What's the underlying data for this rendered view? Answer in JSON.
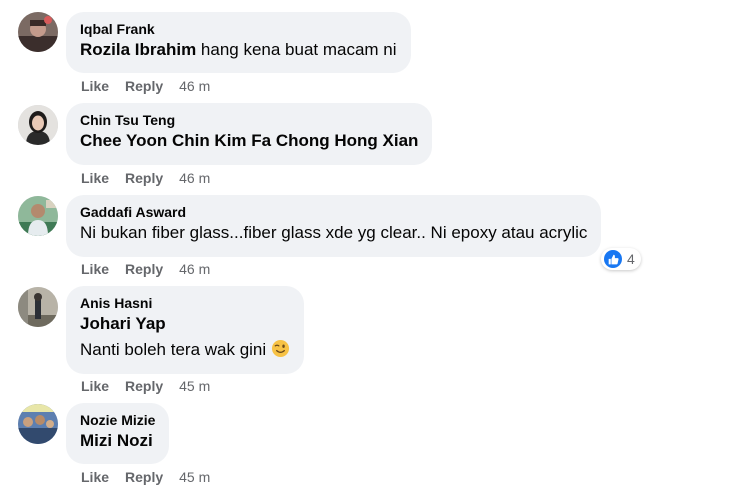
{
  "comments": [
    {
      "author": "Iqbal Frank",
      "mention": "Rozila Ibrahim",
      "text": " hang kena buat macam ni",
      "actions": {
        "like": "Like",
        "reply": "Reply"
      },
      "time": "46 m"
    },
    {
      "author": "Chin Tsu Teng",
      "mention": "Chee Yoon Chin Kim Fa Chong Hong Xian",
      "text": "",
      "actions": {
        "like": "Like",
        "reply": "Reply"
      },
      "time": "46 m"
    },
    {
      "author": "Gaddafi Asward",
      "text": "Ni bukan fiber glass...fiber glass xde yg clear.. Ni epoxy atau acrylic",
      "actions": {
        "like": "Like",
        "reply": "Reply"
      },
      "time": "46 m",
      "reactions": {
        "icon": "thumbs-up-icon",
        "count": "4"
      }
    },
    {
      "author": "Anis Hasni",
      "mention": "Johari Yap",
      "text": "Nanti boleh tera wak gini ",
      "emoji": "winking-face-emoji",
      "actions": {
        "like": "Like",
        "reply": "Reply"
      },
      "time": "45 m"
    },
    {
      "author": "Nozie Mizie",
      "mention": "Mizi Nozi",
      "text": "",
      "actions": {
        "like": "Like",
        "reply": "Reply"
      },
      "time": "45 m"
    }
  ],
  "colors": {
    "bubble": "#f0f2f5",
    "secondary_text": "#65676b",
    "like_blue": "#1877f2"
  }
}
